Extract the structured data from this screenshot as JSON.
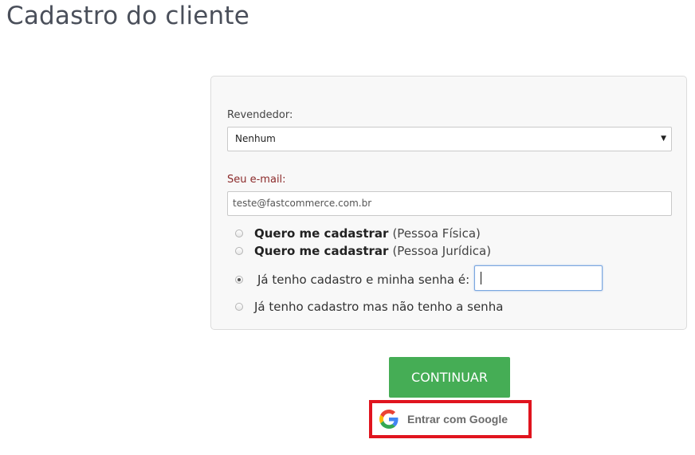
{
  "page": {
    "title": "Cadastro do cliente"
  },
  "form": {
    "reseller_label": "Revendedor:",
    "reseller_value": "Nenhum",
    "email_label": "Seu e-mail:",
    "email_value": "teste@fastcommerce.com.br",
    "options": [
      {
        "bold": "Quero me cadastrar",
        "extra": "(Pessoa Física)",
        "checked": false
      },
      {
        "bold": "Quero me cadastrar",
        "extra": "(Pessoa Jurídica)",
        "checked": false
      },
      {
        "text": "Já tenho cadastro e minha senha é:",
        "checked": true
      },
      {
        "text": "Já tenho cadastro mas não tenho a senha",
        "checked": false
      }
    ],
    "password_value": ""
  },
  "actions": {
    "continue_label": "CONTINUAR",
    "google_label": "Entrar com Google"
  },
  "colors": {
    "continue_bg": "#45ad55",
    "highlight_border": "#e0141e",
    "email_label": "#8b2a2a"
  },
  "icons": {
    "select_arrow": "caret-down-icon",
    "google": "google-g-icon"
  }
}
